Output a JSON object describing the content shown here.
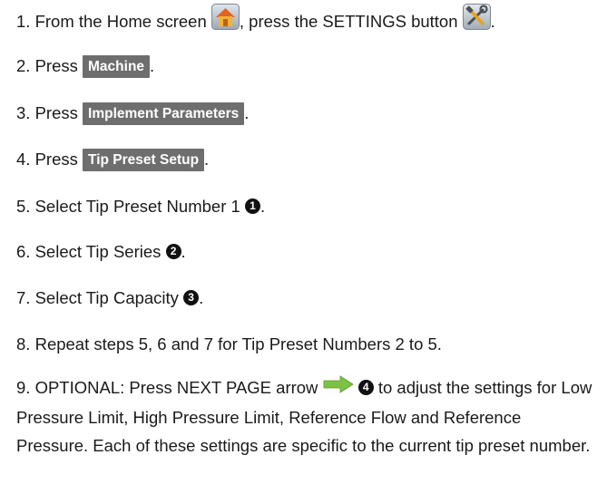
{
  "icons": {
    "home": "home-icon",
    "settings": "settings-tools-icon",
    "next_page": "next-page-arrow-icon"
  },
  "colors": {
    "button_bg": "#6e6e6e",
    "button_text": "#ffffff",
    "arrow_green": "#7dc242"
  },
  "steps": [
    {
      "num": "1.",
      "pre": "From the Home screen",
      "mid": ", press the SETTINGS button",
      "post": "."
    },
    {
      "num": "2.",
      "pre": "Press",
      "button": "Machine",
      "post": "."
    },
    {
      "num": "3.",
      "pre": "Press",
      "button": "Implement Parameters",
      "post": "."
    },
    {
      "num": "4.",
      "pre": "Press",
      "button": "Tip Preset Setup",
      "post": "."
    },
    {
      "num": "5.",
      "pre": "Select Tip Preset Number 1",
      "callout": "1",
      "post": "."
    },
    {
      "num": "6.",
      "pre": "Select Tip Series",
      "callout": "2",
      "post": "."
    },
    {
      "num": "7.",
      "pre": "Select Tip Capacity",
      "callout": "3",
      "post": "."
    },
    {
      "num": "8.",
      "text": "Repeat steps 5, 6 and 7 for Tip Preset Numbers 2 to 5."
    },
    {
      "num": "9.",
      "pre": "OPTIONAL: Press NEXT PAGE arrow",
      "callout": "4",
      "post": "to adjust the settings for Low Pressure Limit, High Pressure Limit, Reference Flow and Reference Pressure. Each of these settings are specific to the current tip preset number."
    }
  ]
}
